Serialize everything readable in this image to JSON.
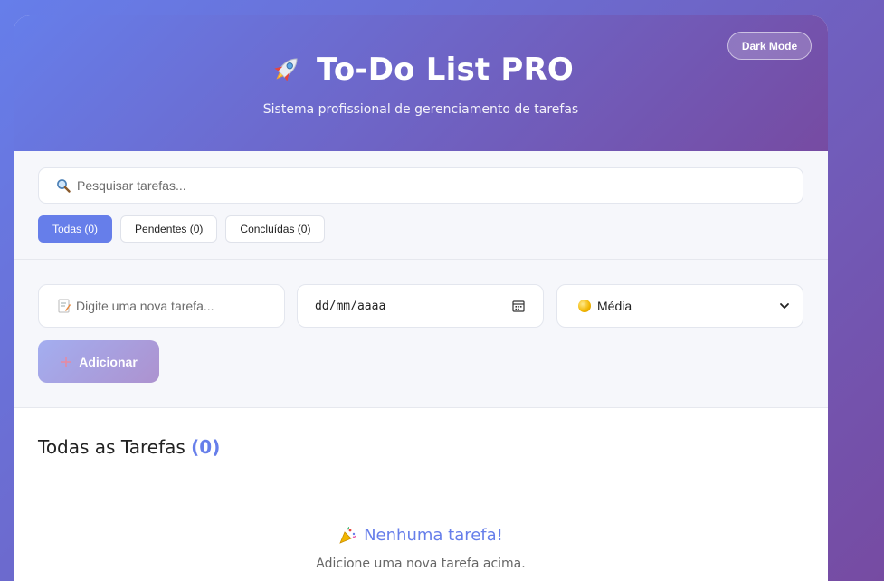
{
  "header": {
    "dark_mode_label": "Dark Mode",
    "title_icon": "rocket-icon",
    "title": "To-Do List PRO",
    "subtitle": "Sistema profissional de gerenciamento de tarefas"
  },
  "search": {
    "icon": "search-icon",
    "placeholder": "Pesquisar tarefas..."
  },
  "filters": [
    {
      "label": "Todas (0)",
      "active": true
    },
    {
      "label": "Pendentes (0)",
      "active": false
    },
    {
      "label": "Concluídas (0)",
      "active": false
    }
  ],
  "add_form": {
    "task_icon": "memo-icon",
    "task_placeholder": "Digite uma nova tarefa...",
    "date_placeholder": "dd/mm/aaaa",
    "priority_selected": "Média",
    "priority_icon": "yellow-circle-icon",
    "add_label": "Adicionar",
    "add_icon": "plus-icon"
  },
  "tasks": {
    "title": "Todas as Tarefas",
    "count": "(0)",
    "empty_icon": "party-popper-icon",
    "empty_title": "Nenhuma tarefa!",
    "empty_subtitle": "Adicione uma nova tarefa acima."
  },
  "colors": {
    "accent": "#667eea",
    "gradient_start": "#667eea",
    "gradient_end": "#764ba2"
  }
}
